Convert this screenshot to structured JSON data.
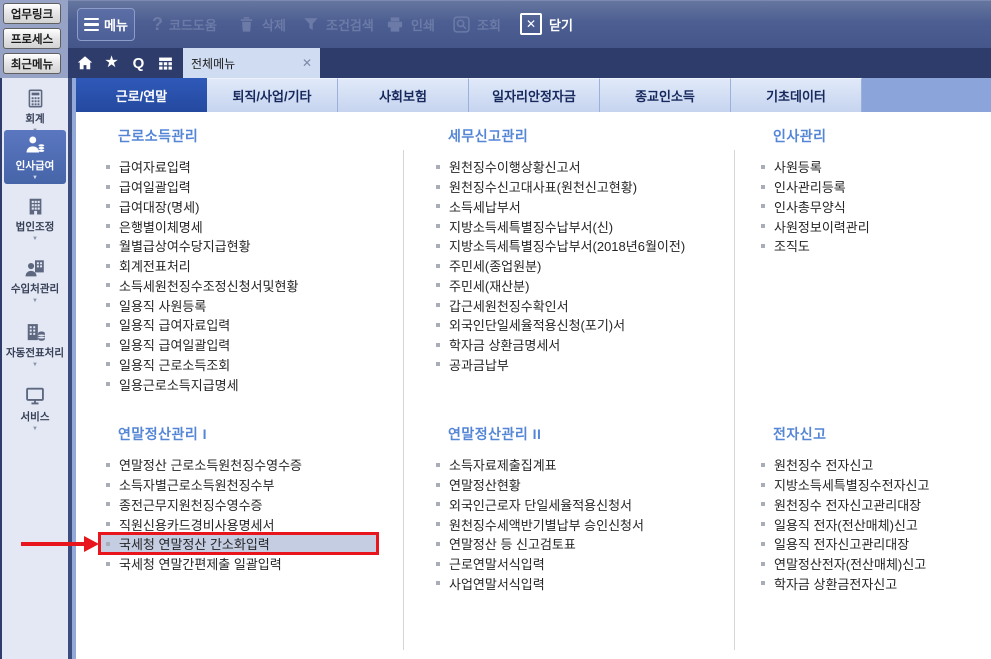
{
  "left_panel": {
    "buttons": [
      "업무링크",
      "프로세스",
      "최근메뉴"
    ],
    "nav_items": [
      {
        "key": "accounting",
        "label": "회계",
        "icon": "calculator-icon",
        "active": false
      },
      {
        "key": "hr-payroll",
        "label": "인사급여",
        "icon": "person-payroll-icon",
        "active": true
      },
      {
        "key": "corporate-adjust",
        "label": "법인조정",
        "icon": "building-icon",
        "active": false
      },
      {
        "key": "revenue-mgmt",
        "label": "수입처관리",
        "icon": "person-building-icon",
        "active": false
      },
      {
        "key": "auto-voucher",
        "label": "자동전표처리",
        "icon": "building-database-icon",
        "active": false
      },
      {
        "key": "service",
        "label": "서비스",
        "icon": "monitor-icon",
        "active": false
      }
    ]
  },
  "toolbar": {
    "menu_label": "메뉴",
    "items": [
      {
        "label": "코드도움",
        "icon": "question-icon",
        "enabled": false
      },
      {
        "label": "삭제",
        "icon": "trash-icon",
        "enabled": false
      },
      {
        "label": "조건검색",
        "icon": "funnel-icon",
        "enabled": false
      },
      {
        "label": "인쇄",
        "icon": "printer-icon",
        "enabled": false
      },
      {
        "label": "조회",
        "icon": "magnifier-icon",
        "enabled": false
      }
    ],
    "close_label": "닫기"
  },
  "tab_bar": {
    "icons": [
      "home-icon",
      "star-icon",
      "quick-search-icon",
      "calendar-icon"
    ],
    "document_tab": {
      "label": "전체메뉴",
      "close_glyph": "✕"
    }
  },
  "main_tabs": [
    {
      "key": "labor-yearend",
      "label": "근로/연말",
      "active": true
    },
    {
      "key": "retirement-business-etc",
      "label": "퇴직/사업/기타",
      "active": false
    },
    {
      "key": "social-insurance",
      "label": "사회보험",
      "active": false
    },
    {
      "key": "job-stability-fund",
      "label": "일자리안정자금",
      "active": false
    },
    {
      "key": "religious-income",
      "label": "종교인소득",
      "active": false
    },
    {
      "key": "base-data",
      "label": "기초데이터",
      "active": false
    }
  ],
  "menu_sections": [
    {
      "key": "work-income-mgmt",
      "title": "근로소득관리",
      "col": 0,
      "row": 0,
      "items": [
        "급여자료입력",
        "급여일괄입력",
        "급여대장(명세)",
        "은행별이체명세",
        "월별급상여수당지급현황",
        "회계전표처리",
        "소득세원천징수조정신청서및현황",
        "일용직 사원등록",
        "일용직 급여자료입력",
        "일용직 급여일괄입력",
        "일용직 근로소득조회",
        "일용근로소득지급명세"
      ]
    },
    {
      "key": "tax-report-mgmt",
      "title": "세무신고관리",
      "col": 1,
      "row": 0,
      "items": [
        "원천징수이행상황신고서",
        "원천징수신고대사표(원천신고현황)",
        "소득세납부서",
        "지방소득세특별징수납부서(신)",
        "지방소득세특별징수납부서(2018년6월이전)",
        "주민세(종업원분)",
        "주민세(재산분)",
        "갑근세원천징수확인서",
        "외국인단일세율적용신청(포기)서",
        "학자금 상환금명세서",
        "공과금납부"
      ]
    },
    {
      "key": "hr-mgmt",
      "title": "인사관리",
      "col": 2,
      "row": 0,
      "items": [
        "사원등록",
        "인사관리등록",
        "인사총무양식",
        "사원정보이력관리",
        "조직도"
      ]
    },
    {
      "key": "yearend-settlement-1",
      "title": "연말정산관리  I",
      "col": 0,
      "row": 1,
      "highlight_index": 4,
      "items": [
        "연말정산 근로소득원천징수영수증",
        "소득자별근로소득원천징수부",
        "종전근무지원천징수영수증",
        "직원신용카드경비사용명세서",
        "국세청 연말정산 간소화입력",
        "국세청 연말간편제출 일괄입력"
      ]
    },
    {
      "key": "yearend-settlement-2",
      "title": "연말정산관리  II",
      "col": 1,
      "row": 1,
      "items": [
        "소득자료제출집계표",
        "연말정산현황",
        "외국인근로자 단일세율적용신청서",
        "원천징수세액반기별납부 승인신청서",
        "연말정산 등 신고검토표",
        "근로연말서식입력",
        "사업연말서식입력"
      ]
    },
    {
      "key": "e-filing",
      "title": "전자신고",
      "col": 2,
      "row": 1,
      "items": [
        "원천징수 전자신고",
        "지방소득세특별징수전자신고",
        "원천징수 전자신고관리대장",
        "일용직 전자(전산매체)신고",
        "일용직 전자신고관리대장",
        "연말정산전자(전산매체)신고",
        "학자금 상환금전자신고"
      ]
    }
  ],
  "annotation": {
    "highlighted_item": "국세청 연말정산 간소화입력",
    "arrow_color": "#e8151c",
    "box_border_color": "#e8151c",
    "box_fill_color": "#c5cde3"
  },
  "colors": {
    "toolbar_bg": "#4d5f92",
    "icon_row_bg": "#2d3c6a",
    "active_tab": "#2a51ae",
    "inactive_tab": "#cdd9f1",
    "section_header": "#5586d6",
    "sidebar_bg": "#e3e8f4",
    "sidebar_active": "#4f6cb4"
  }
}
